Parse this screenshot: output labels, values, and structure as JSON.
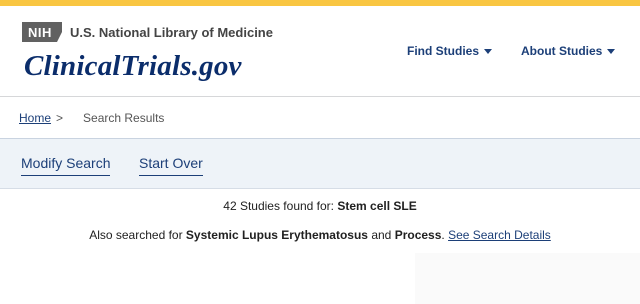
{
  "header": {
    "nih_badge": "NIH",
    "nlm_title": "U.S. National Library of Medicine",
    "site_title": "ClinicalTrials.gov"
  },
  "nav": {
    "find_studies": "Find Studies",
    "about_studies": "About Studies"
  },
  "breadcrumb": {
    "home": "Home",
    "separator": ">",
    "current": "Search Results"
  },
  "actions": {
    "modify_search": "Modify Search",
    "start_over": "Start Over"
  },
  "results": {
    "count_text": "42 Studies found for: ",
    "query": "Stem cell SLE"
  },
  "also_searched": {
    "prefix": "Also searched for ",
    "term1": "Systemic Lupus Erythematosus",
    "and": " and ",
    "term2": "Process",
    "dot": ". ",
    "details_link": "See Search Details"
  },
  "colors": {
    "top_bar": "#f9c642",
    "brand_blue": "#0b2d6b",
    "link_blue": "#1c3f78",
    "action_bar": "#eef3f8"
  }
}
